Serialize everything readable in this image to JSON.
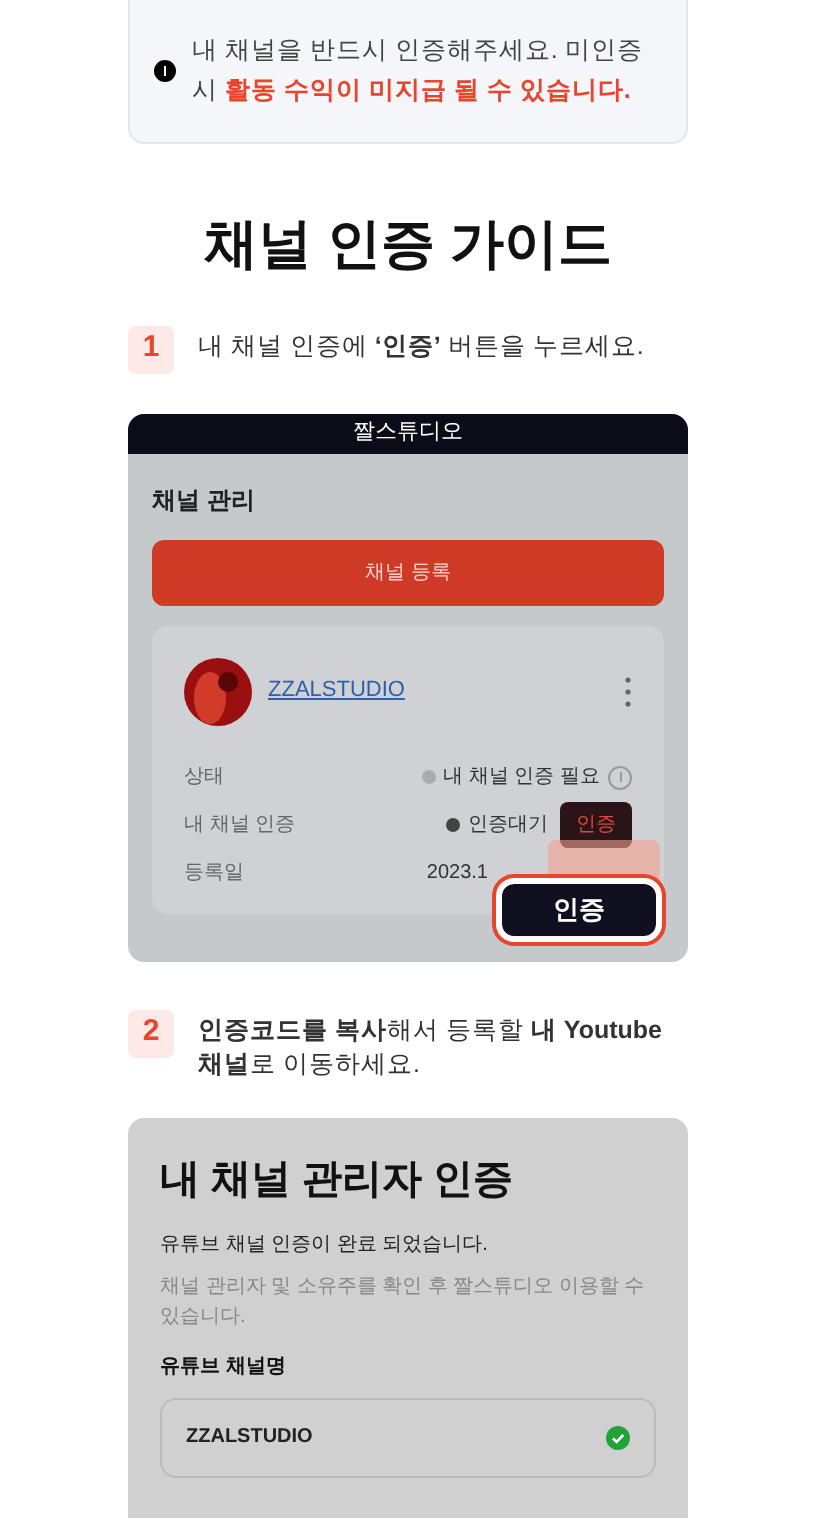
{
  "notice": {
    "text": "내 채널을 반드시 인증해주세요. 미인증 시 **활동 수익이 미지급 될 수 있습니다.**"
  },
  "title": "채널 인증 가이드",
  "steps": [
    {
      "number": "1",
      "text": "내 채널 인증에 **‘인증’** 버튼을 누르세요."
    },
    {
      "number": "2",
      "text": "**인증코드를 복사**해서 등록할 **내 Youtube 채널**로 이동하세요."
    }
  ],
  "screen_1": {
    "app_title": "짤스튜디오",
    "heading": "채널 관리",
    "register_button": "채널 등록",
    "channel": {
      "name": "ZZALSTUDIO",
      "rows": [
        {
          "kind": "status",
          "label": "상태",
          "value": "내 채널 인증 필요"
        },
        {
          "kind": "pending",
          "label": "내 채널 인증",
          "value": "인증대기",
          "button": "인증"
        },
        {
          "kind": "date",
          "label": "등록일",
          "value": "2023.1"
        }
      ]
    },
    "highlight_button": "인증"
  },
  "screen_2": {
    "title": "내 채널 관리자 인증",
    "message": "유튜브 채널 인증이 완료 되었습니다.",
    "note": "채널 관리자 및 소유주를 확인 후 짤스튜디오 이용할 수 있습니다.",
    "field_label": "유튜브 채널명",
    "field_value": "ZZALSTUDIO",
    "verified": true
  }
}
